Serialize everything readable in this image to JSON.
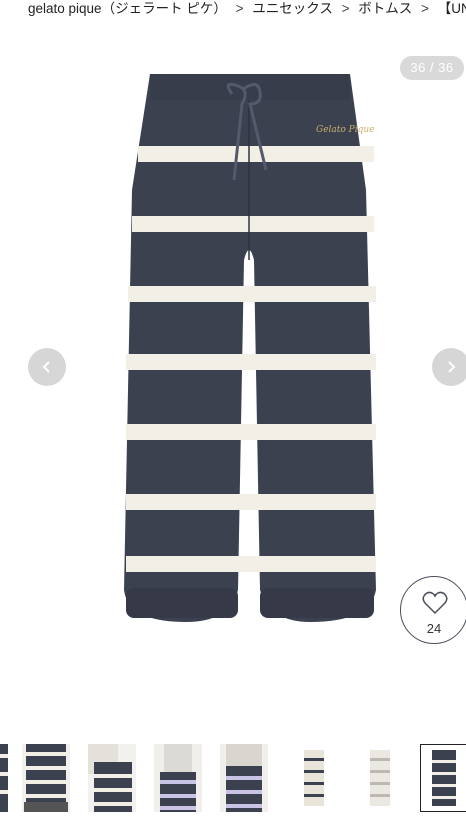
{
  "breadcrumb": {
    "items": [
      "gelato pique（ジェラート ピケ）",
      "ユニセックス",
      "ボトムス",
      "【UNIS"
    ],
    "separator": ">"
  },
  "gallery": {
    "counter": "36 / 36",
    "prev_icon": "chevron-left-icon",
    "next_icon": "chevron-right-icon",
    "product_logo_text": "Gelato Pique"
  },
  "favorite": {
    "icon": "heart-outline-icon",
    "count": "24"
  },
  "colors": {
    "navy": "#3c4150",
    "cream": "#f1efe6",
    "lavender": "#c9c3e6"
  }
}
